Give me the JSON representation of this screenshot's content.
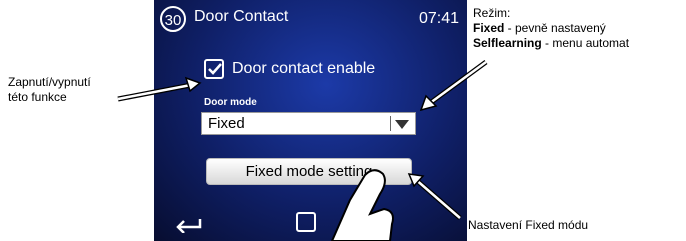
{
  "screen": {
    "number": "30",
    "title": "Door Contact",
    "time": "07:41",
    "checkbox_label": "Door contact enable",
    "door_mode_label": "Door mode",
    "door_mode_value": "Fixed",
    "button_label": "Fixed mode setting"
  },
  "annotations": {
    "left_line1": "Zapnutí/vypnutí",
    "left_line2": "této funkce",
    "rezim_title": "Režim:",
    "fixed_bold": "Fixed",
    "fixed_desc": " - pevně nastavený",
    "self_bold": "Selflearning",
    "self_desc": " - menu automat",
    "bottom_right": "Nastavení Fixed módu"
  },
  "icons": [
    "back-arrow-icon",
    "home-square-icon",
    "checkmark-icon",
    "dropdown-arrow-icon",
    "pointing-finger-icon"
  ]
}
